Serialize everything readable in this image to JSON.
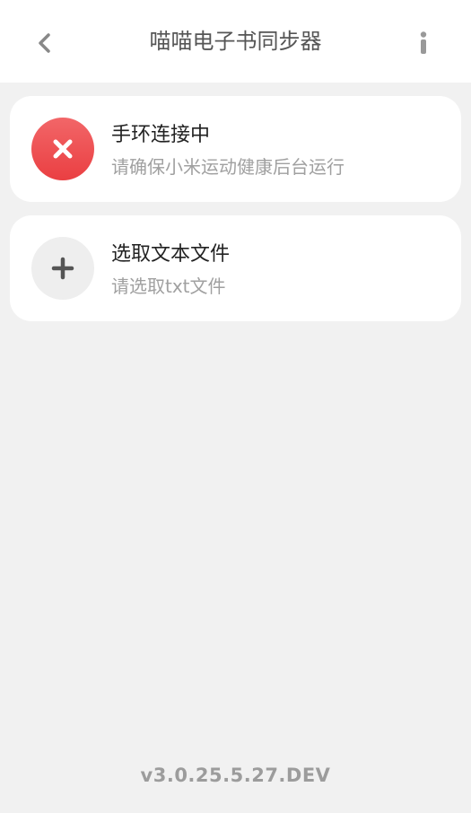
{
  "header": {
    "title": "喵喵电子书同步器",
    "back_icon": "chevron-left-icon",
    "info_icon": "info-icon"
  },
  "cards": [
    {
      "title": "手环连接中",
      "subtitle": "请确保小米运动健康后台运行",
      "icon": "close-icon",
      "icon_color": "#ea3f42"
    },
    {
      "title": "选取文本文件",
      "subtitle": "请选取txt文件",
      "icon": "plus-icon",
      "icon_color": "#555555"
    }
  ],
  "footer": {
    "version": "v3.0.25.5.27.DEV"
  },
  "colors": {
    "background": "#f1f1f1",
    "card": "#ffffff",
    "error": "#ea3f42",
    "muted_text": "#a0a0a0"
  }
}
